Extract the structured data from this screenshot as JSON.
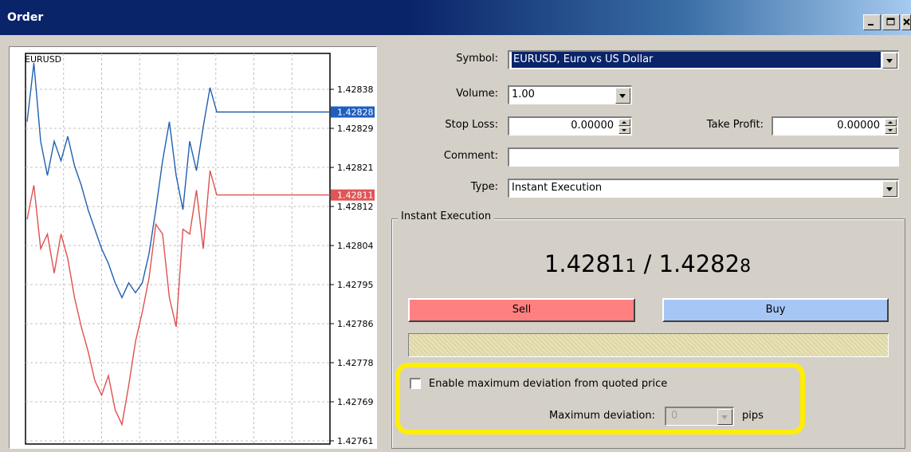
{
  "window": {
    "title": "Order",
    "controls": [
      "minimize-icon",
      "maximize-icon",
      "close-icon"
    ]
  },
  "chart": {
    "symbol": "EURUSD",
    "price_labels": [
      "1.42838",
      "1.42829",
      "1.42821",
      "1.42812",
      "1.42804",
      "1.42795",
      "1.42786",
      "1.42778",
      "1.42769",
      "1.42761"
    ],
    "ask_marker": "1.42828",
    "bid_marker": "1.42811",
    "colors": {
      "ask": "#2060b0",
      "bid": "#e05050",
      "ask_marker_bg": "#1f5fbf",
      "bid_marker_bg": "#e05555",
      "grid": "#c0c0c0"
    }
  },
  "chart_data": {
    "type": "line",
    "ylim": [
      1.4276,
      1.4284
    ],
    "series": [
      {
        "values": [
          1.42826,
          1.42838,
          1.42822,
          1.42815,
          1.42822,
          1.42818,
          1.42823,
          1.42817,
          1.42813,
          1.42808,
          1.42804,
          1.428,
          1.42797,
          1.42793,
          1.4279,
          1.42793,
          1.42791,
          1.42793,
          1.42799,
          1.42808,
          1.42818,
          1.42826,
          1.42815,
          1.42808,
          1.42822,
          1.42816,
          1.42825,
          1.42833,
          1.42828
        ]
      },
      {
        "values": [
          1.42806,
          1.42813,
          1.428,
          1.42803,
          1.42795,
          1.42803,
          1.42798,
          1.4279,
          1.42784,
          1.42779,
          1.42773,
          1.4277,
          1.42774,
          1.42767,
          1.42764,
          1.42772,
          1.42781,
          1.42787,
          1.42794,
          1.42805,
          1.42803,
          1.4279,
          1.42784,
          1.42804,
          1.42803,
          1.42812,
          1.428,
          1.42816,
          1.42811
        ]
      }
    ]
  },
  "form": {
    "symbol_label": "Symbol:",
    "symbol_value": "EURUSD, Euro vs US Dollar",
    "volume_label": "Volume:",
    "volume_value": "1.00",
    "stoploss_label": "Stop Loss:",
    "stoploss_value": "0.00000",
    "takeprofit_label": "Take Profit:",
    "takeprofit_value": "0.00000",
    "comment_label": "Comment:",
    "comment_value": "",
    "type_label": "Type:",
    "type_value": "Instant Execution"
  },
  "execution": {
    "group_title": "Instant Execution",
    "bid_main": "1.4281",
    "bid_small": "1",
    "separator": " / ",
    "ask_main": "1.4282",
    "ask_small": "8",
    "sell_label": "Sell",
    "buy_label": "Buy",
    "sell_color": "#ff8080",
    "buy_color": "#a6c6f5",
    "deviation_checkbox_label": "Enable maximum deviation from quoted price",
    "deviation_checked": false,
    "max_deviation_label": "Maximum deviation:",
    "max_deviation_value": "0",
    "pips_label": "pips",
    "highlight_color": "#ffee00"
  }
}
